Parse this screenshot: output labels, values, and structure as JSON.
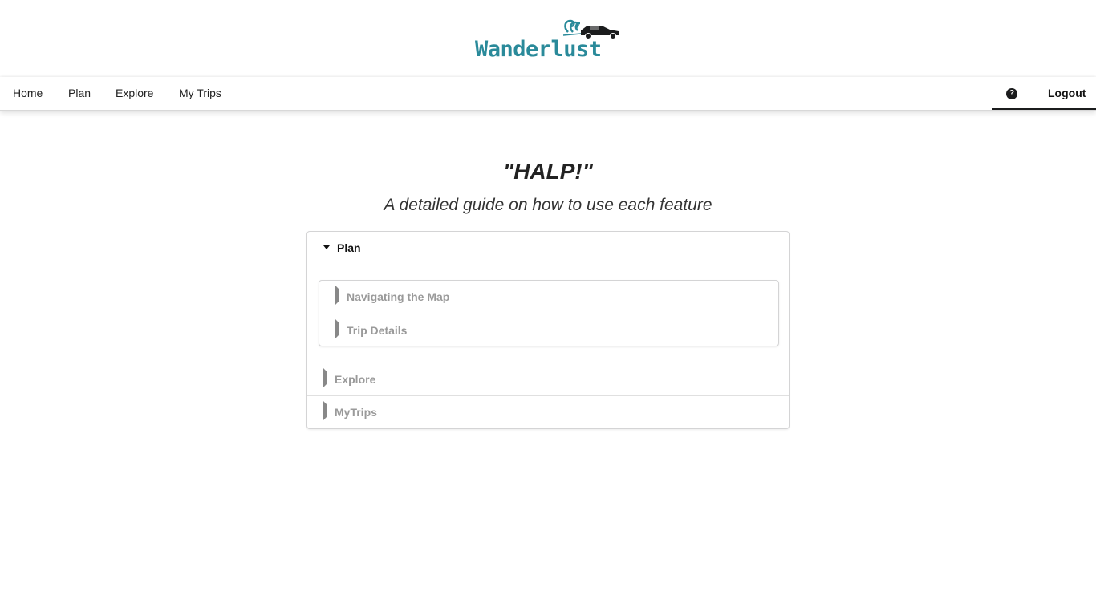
{
  "brand": {
    "name": "Wanderlust",
    "accent_color": "#2a8a9a"
  },
  "nav": {
    "home": "Home",
    "plan": "Plan",
    "explore": "Explore",
    "my_trips": "My Trips",
    "help_icon": "question-circle-icon",
    "logout": "Logout"
  },
  "page": {
    "title": "\"HALP!\"",
    "subtitle": "A detailed guide on how to use each feature"
  },
  "accordion": {
    "sections": [
      {
        "label": "Plan",
        "expanded": true,
        "children": [
          {
            "label": "Navigating the Map",
            "expanded": false
          },
          {
            "label": "Trip Details",
            "expanded": false
          }
        ]
      },
      {
        "label": "Explore",
        "expanded": false
      },
      {
        "label": "MyTrips",
        "expanded": false
      }
    ]
  }
}
